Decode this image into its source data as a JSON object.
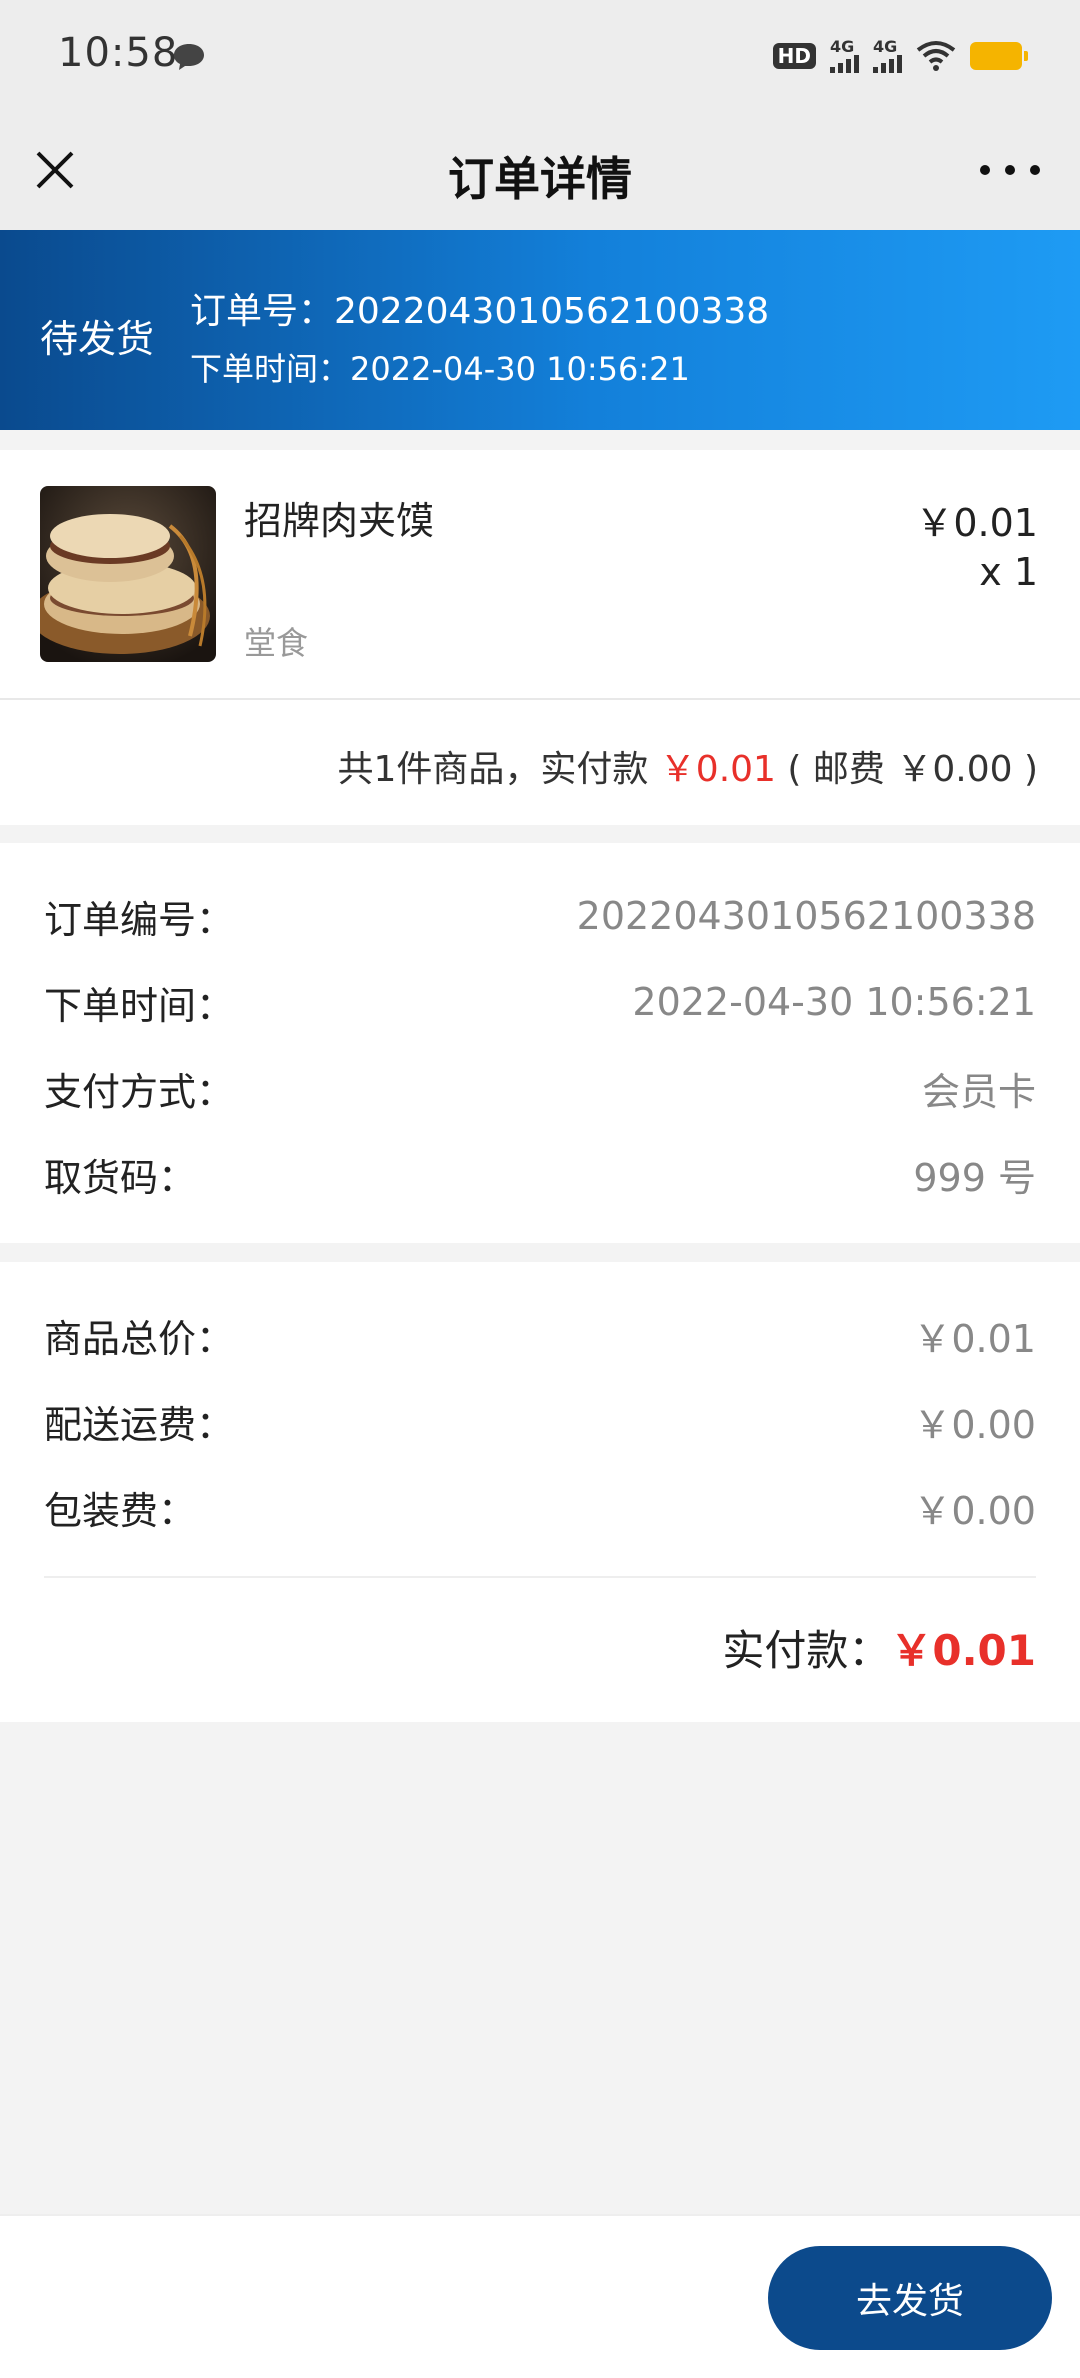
{
  "status_bar": {
    "time": "10:58",
    "hd_label": "HD",
    "signal1_label": "4G",
    "signal2_label": "4G"
  },
  "nav": {
    "title": "订单详情",
    "close_icon": "close-icon",
    "more_icon": "more-icon"
  },
  "banner": {
    "status": "待发货",
    "order_number_line": "订单号：2022043010562100338",
    "order_time_line": "下单时间：2022-04-30 10:56:21"
  },
  "product": {
    "name": "招牌肉夹馍",
    "tag": "堂食",
    "price": "￥0.01",
    "quantity": "x 1",
    "summary_prefix": "共1件商品，实付款 ",
    "summary_amount": "￥0.01",
    "summary_suffix": " ( 邮费 ￥0.00 )"
  },
  "order_info": {
    "rows": [
      {
        "label": "订单编号：",
        "value": "2022043010562100338"
      },
      {
        "label": "下单时间：",
        "value": "2022-04-30 10:56:21"
      },
      {
        "label": "支付方式：",
        "value": "会员卡"
      },
      {
        "label": "取货码：",
        "value": "999 号"
      }
    ]
  },
  "cost_info": {
    "rows": [
      {
        "label": "商品总价：",
        "value": "￥0.01"
      },
      {
        "label": "配送运费：",
        "value": "￥0.00"
      },
      {
        "label": "包装费：",
        "value": "￥0.00"
      }
    ],
    "total_label": "实付款：",
    "total_value": "￥0.01"
  },
  "footer": {
    "ship_button": "去发货"
  },
  "colors": {
    "accent": "#0c4a8c",
    "price_red": "#e8302a",
    "banner_start": "#0a4a8e",
    "banner_end": "#1e9bf4"
  }
}
